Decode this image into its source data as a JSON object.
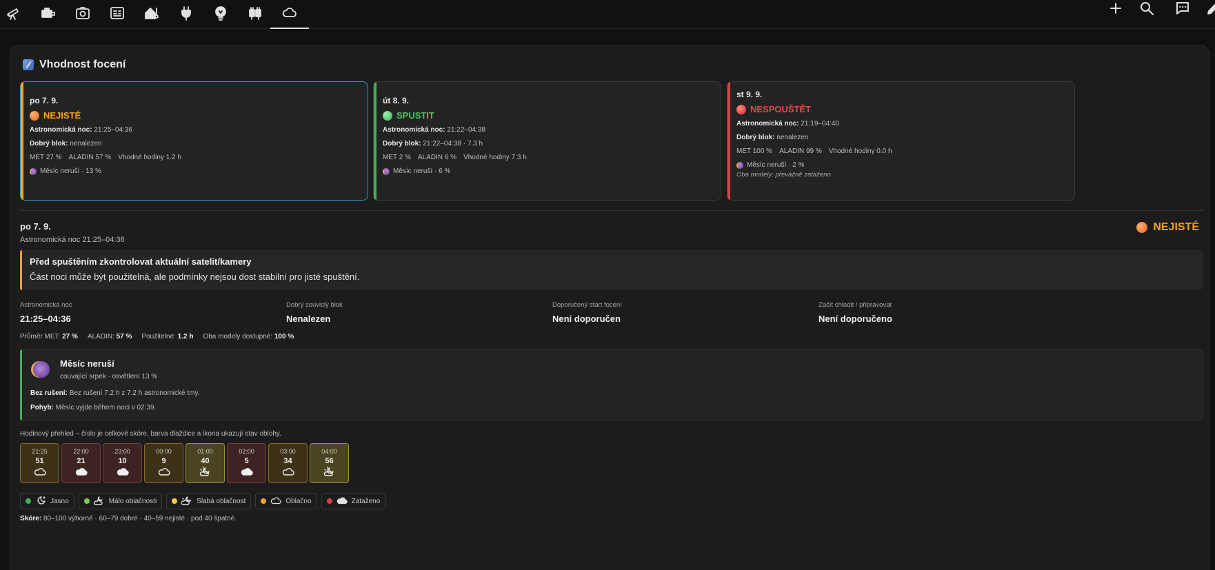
{
  "topbar": {
    "tabs": [
      {
        "name": "telescope"
      },
      {
        "name": "camera-body"
      },
      {
        "name": "camera"
      },
      {
        "name": "view-dashboard"
      },
      {
        "name": "home-thermometer"
      },
      {
        "name": "power-plug"
      },
      {
        "name": "lightbulb"
      },
      {
        "name": "power-plugs"
      },
      {
        "name": "weather-cloudy",
        "active": true
      }
    ],
    "actions": [
      "plus-icon",
      "search-icon",
      "message-icon",
      "pencil-icon"
    ]
  },
  "panel": {
    "title": "Vhodnost focení"
  },
  "days": [
    {
      "date": "po 7. 9.",
      "status": "NEJISTÉ",
      "status_color": "#f5a223",
      "night_label": "Astronomická noc:",
      "night_value": "21:25–04:36",
      "block_label": "Dobrý blok:",
      "block_value": "nenalezen",
      "met": "MET 27 %",
      "aladin": "ALADIN 57 %",
      "hours": "Vhodné hodiny 1.2 h",
      "moon": "Měsíc neruší · 13 %"
    },
    {
      "date": "út 8. 9.",
      "status": "SPUSTIT",
      "status_color": "#4cc45f",
      "night_label": "Astronomická noc:",
      "night_value": "21:22–04:38",
      "block_label": "Dobrý blok:",
      "block_value": "21:22–04:38 · 7.3 h",
      "met": "MET 2 %",
      "aladin": "ALADIN 6 %",
      "hours": "Vhodné hodiny 7.3 h",
      "moon": "Měsíc neruší · 6 %"
    },
    {
      "date": "st 9. 9.",
      "status": "NESPOUŠTĚT",
      "status_color": "#e14a4a",
      "night_label": "Astronomická noc:",
      "night_value": "21:19–04:40",
      "block_label": "Dobrý blok:",
      "block_value": "nenalezen",
      "met": "MET 100 %",
      "aladin": "ALADIN 99 %",
      "hours": "Vhodné hodiny 0.0 h",
      "moon": "Měsíc neruší · 2 %",
      "note": "Oba modely: převážně zataženo"
    }
  ],
  "detail": {
    "date": "po 7. 9.",
    "night": "Astronomická noc 21:25–04:36",
    "status": "NEJISTÉ",
    "warning": {
      "title": "Před spuštěním zkontrolovat aktuální satelit/kamery",
      "text": "Část noci může být použitelná, ale podmínky nejsou dost stabilní pro jisté spuštění."
    },
    "stats": [
      {
        "label": "Astronomická noc",
        "value": "21:25–04:36"
      },
      {
        "label": "Dobrý souvislý blok",
        "value": "Nenalezen"
      },
      {
        "label": "Doporučený start focení",
        "value": "Není doporučen"
      },
      {
        "label": "Začít chladit / připravovat",
        "value": "Není doporučeno"
      }
    ],
    "averages": {
      "met_label": "Průměr MET:",
      "met_value": "27 %",
      "aladin_label": "ALADIN:",
      "aladin_value": "57 %",
      "usable_label": "Použitelné:",
      "usable_value": "1.2 h",
      "both_label": "Oba modely dostupné:",
      "both_value": "100 %"
    },
    "moon": {
      "title": "Měsíc neruší",
      "subtitle": "couvající srpek · osvětlení 13 %",
      "free_label": "Bez rušení:",
      "free_value": "Bez rušení 7.2 h z 7.2 h astronomické tmy.",
      "move_label": "Pohyb:",
      "move_value": "Měsíc vyjde během noci v 02:39."
    },
    "hourly_caption": "Hodinový přehled – číslo je celkové skóre, barva dlaždice a ikona ukazují stav oblohy.",
    "hours": [
      {
        "time": "21:25",
        "score": "51",
        "icon": "cloudy-icon",
        "level": "mid"
      },
      {
        "time": "22:00",
        "score": "21",
        "icon": "overcast-icon",
        "level": "bad"
      },
      {
        "time": "23:00",
        "score": "10",
        "icon": "overcast-icon",
        "level": "bad"
      },
      {
        "time": "00:00",
        "score": "9",
        "icon": "cloudy-icon",
        "level": "mid"
      },
      {
        "time": "01:00",
        "score": "40",
        "icon": "night-partly-cloudy-icon",
        "level": "ok"
      },
      {
        "time": "02:00",
        "score": "5",
        "icon": "overcast-icon",
        "level": "bad"
      },
      {
        "time": "03:00",
        "score": "34",
        "icon": "cloudy-icon",
        "level": "mid"
      },
      {
        "time": "04:00",
        "score": "56",
        "icon": "night-partly-cloudy-icon",
        "level": "ok"
      }
    ],
    "legend": [
      {
        "label": "Jasno",
        "color": "#3fae54",
        "icon": "clear-night-icon"
      },
      {
        "label": "Málo oblačnosti",
        "color": "#7ec850",
        "icon": "few-clouds-icon"
      },
      {
        "label": "Slabá oblačnost",
        "color": "#f0d040",
        "icon": "partly-cloudy-icon"
      },
      {
        "label": "Oblačno",
        "color": "#f4a32a",
        "icon": "cloudy-icon"
      },
      {
        "label": "Zataženo",
        "color": "#d24444",
        "icon": "overcast-icon"
      }
    ],
    "score_legend_label": "Skóre:",
    "score_legend_text": "80–100 výborné · 60–79 dobré · 40–59 nejisté · pod 40 špatné."
  }
}
